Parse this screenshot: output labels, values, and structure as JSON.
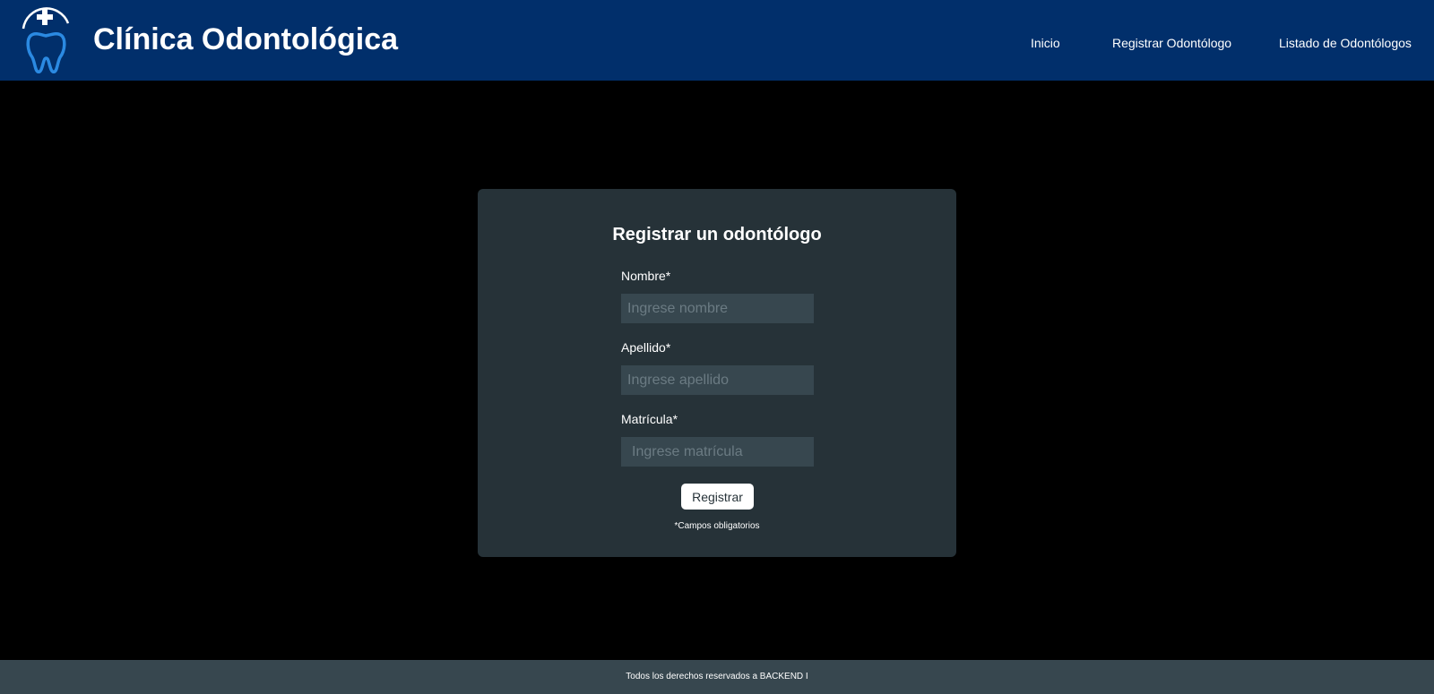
{
  "header": {
    "brand": "Clínica Odontológica",
    "logo_icon": "tooth-icon",
    "colors": {
      "background": "#012f6b",
      "logo_accent": "#2b8ae2"
    },
    "nav": {
      "inicio": "Inicio",
      "registrar": "Registrar Odontólogo",
      "listado": "Listado de Odontólogos"
    }
  },
  "form": {
    "title": "Registrar un odontólogo",
    "fields": {
      "nombre": {
        "label": "Nombre*",
        "placeholder": "Ingrese nombre"
      },
      "apellido": {
        "label": "Apellido*",
        "placeholder": "Ingrese apellido"
      },
      "matricula": {
        "label": "Matrícula*",
        "placeholder": "Ingrese matrícula"
      }
    },
    "submit_label": "Registrar",
    "required_note": "*Campos obligatorios",
    "colors": {
      "card": "#263238",
      "input": "#37474f"
    }
  },
  "footer": {
    "text": "Todos los derechos reservados a BACKEND I",
    "color": "#37474f"
  }
}
